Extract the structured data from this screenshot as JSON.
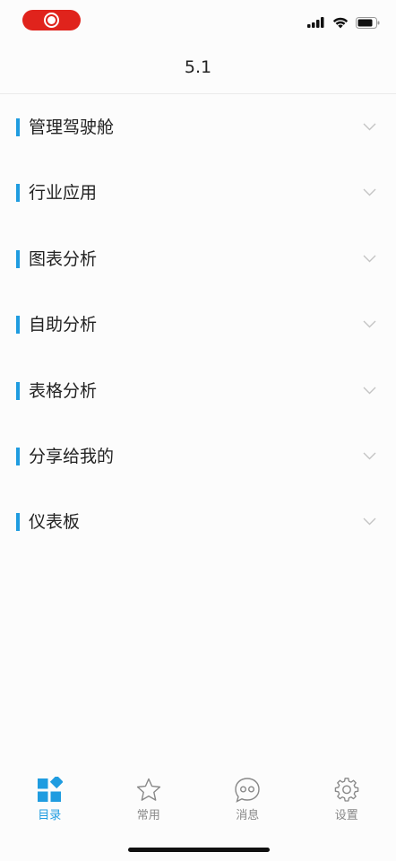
{
  "nav": {
    "title": "5.1"
  },
  "status_bar": {
    "recording_indicator": "record-icon",
    "signal_icon": "cellular-signal-icon",
    "wifi_icon": "wifi-icon",
    "battery_icon": "battery-icon"
  },
  "menu": {
    "items": [
      {
        "label": "管理驾驶舱"
      },
      {
        "label": "行业应用"
      },
      {
        "label": "图表分析"
      },
      {
        "label": "自助分析"
      },
      {
        "label": "表格分析"
      },
      {
        "label": "分享给我的"
      },
      {
        "label": "仪表板"
      }
    ]
  },
  "tabbar": {
    "tabs": [
      {
        "label": "目录",
        "icon": "catalog-icon",
        "active": true
      },
      {
        "label": "常用",
        "icon": "star-icon",
        "active": false
      },
      {
        "label": "消息",
        "icon": "message-icon",
        "active": false
      },
      {
        "label": "设置",
        "icon": "gear-icon",
        "active": false
      }
    ]
  },
  "colors": {
    "accent": "#1f9ce0",
    "record": "#e0231c",
    "inactive": "#888888"
  }
}
